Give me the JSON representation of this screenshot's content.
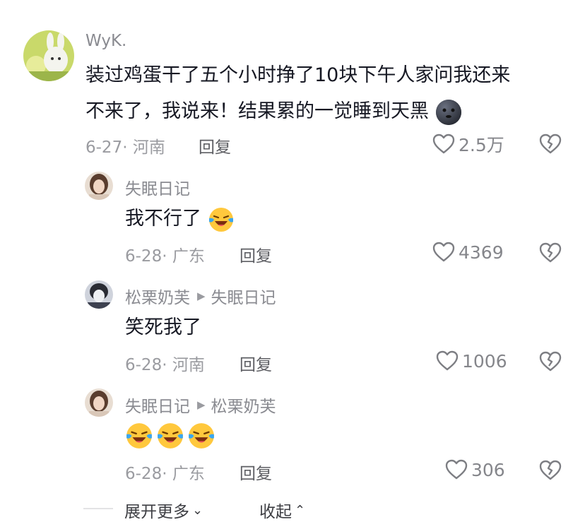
{
  "comments": [
    {
      "author": "WyK.",
      "lines": [
        "装过鸡蛋干了五个小时挣了10块下午人家问我还来",
        "不来了，我说来！结果累的一觉睡到天黑"
      ],
      "date_location": "6-27· 河南",
      "reply_label": "回复",
      "likes": "2.5万",
      "trailing_emoji": "dark-moon-face-emoji"
    },
    {
      "author": "失眠日记",
      "text": "我不行了",
      "date_location": "6-28· 广东",
      "reply_label": "回复",
      "likes": "4369",
      "trailing_emoji": "loudly-crying-laughing-emoji"
    },
    {
      "author": "松栗奶芙",
      "reply_to": "失眠日记",
      "text": "笑死我了",
      "date_location": "6-28· 河南",
      "reply_label": "回复",
      "likes": "1006"
    },
    {
      "author": "失眠日记",
      "reply_to": "松栗奶芙",
      "text": "",
      "emoji_count": 3,
      "date_location": "6-28· 广东",
      "reply_label": "回复",
      "likes": "306"
    }
  ],
  "footer": {
    "expand_label": "展开更多",
    "collapse_label": "收起"
  },
  "icons": {
    "like": "heart-outline-icon",
    "dislike": "broken-heart-icon",
    "reply_arrow": "triangle-right-icon"
  },
  "colors": {
    "text_primary": "#161823",
    "text_secondary": "#8a8b91",
    "reply": "#5d5e63"
  }
}
